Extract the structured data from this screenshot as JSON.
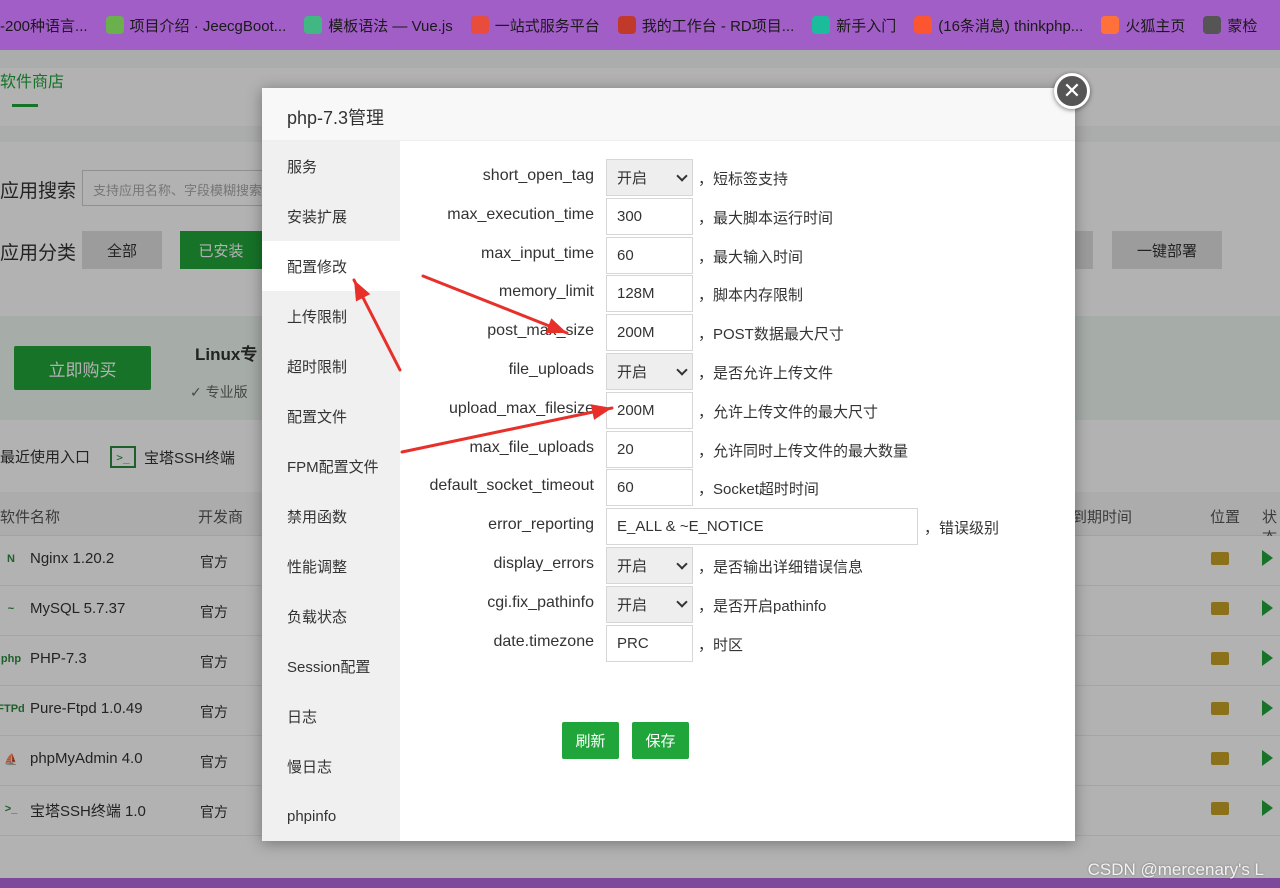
{
  "bookmarks": [
    {
      "label": "-200种语言...",
      "icon": "",
      "color": ""
    },
    {
      "label": "项目介绍 · JeecgBoot...",
      "icon": "jeecg-icon",
      "color": "#6ab04c"
    },
    {
      "label": "模板语法 — Vue.js",
      "icon": "vue-icon",
      "color": "#41b883"
    },
    {
      "label": "一站式服务平台",
      "icon": "service-icon",
      "color": "#e74c3c"
    },
    {
      "label": "我的工作台 - RD项目...",
      "icon": "redmine-icon",
      "color": "#c0392b"
    },
    {
      "label": "新手入门",
      "icon": "guide-icon",
      "color": "#1abc9c"
    },
    {
      "label": "(16条消息) thinkphp...",
      "icon": "csdn-icon",
      "color": "#fc5531"
    },
    {
      "label": "火狐主页",
      "icon": "firefox-icon",
      "color": "#ff7139"
    },
    {
      "label": "蒙检",
      "icon": "globe-icon",
      "color": "#555555"
    }
  ],
  "background": {
    "tab": "软件商店",
    "search_label": "应用搜索",
    "search_placeholder": "支持应用名称、字段模糊搜索",
    "category_label": "应用分类",
    "category_buttons": [
      "全部",
      "已安装"
    ],
    "deploy_button": "一键部署",
    "buy_button": "立即购买",
    "promo_title": "Linux专",
    "promo_sub": "✓ 专业版",
    "recent_entry": "最近使用入口",
    "ssh_terminal": "宝塔SSH终端",
    "table_headers": {
      "name": "软件名称",
      "developer": "开发商",
      "expiry": "到期时间",
      "location": "位置",
      "status": "状态"
    },
    "rows": [
      {
        "name": "Nginx 1.20.2",
        "developer": "官方",
        "icon": "nginx-icon",
        "icon_text": "N"
      },
      {
        "name": "MySQL 5.7.37",
        "developer": "官方",
        "icon": "mysql-icon",
        "icon_text": "~"
      },
      {
        "name": "PHP-7.3",
        "developer": "官方",
        "icon": "php-icon",
        "icon_text": "php"
      },
      {
        "name": "Pure-Ftpd 1.0.49",
        "developer": "官方",
        "icon": "ftp-icon",
        "icon_text": "FTPd"
      },
      {
        "name": "phpMyAdmin 4.0",
        "developer": "官方",
        "icon": "phpmyadmin-icon",
        "icon_text": "⛵"
      },
      {
        "name": "宝塔SSH终端 1.0",
        "developer": "官方",
        "icon": "terminal-icon",
        "icon_text": ">_"
      }
    ]
  },
  "modal": {
    "title": "php-7.3管理",
    "close_icon": "close-icon",
    "sidebar": [
      "服务",
      "安装扩展",
      "配置修改",
      "上传限制",
      "超时限制",
      "配置文件",
      "FPM配置文件",
      "禁用函数",
      "性能调整",
      "负载状态",
      "Session配置",
      "日志",
      "慢日志",
      "phpinfo"
    ],
    "active_sidebar": "配置修改",
    "fields": [
      {
        "label": "short_open_tag",
        "type": "select",
        "value": "开启",
        "desc": "，短标签支持"
      },
      {
        "label": "max_execution_time",
        "type": "input",
        "value": "300",
        "desc": "，最大脚本运行时间"
      },
      {
        "label": "max_input_time",
        "type": "input",
        "value": "60",
        "desc": "，最大输入时间"
      },
      {
        "label": "memory_limit",
        "type": "input",
        "value": "128M",
        "desc": "，脚本内存限制"
      },
      {
        "label": "post_max_size",
        "type": "input",
        "value": "200M",
        "desc": "，POST数据最大尺寸"
      },
      {
        "label": "file_uploads",
        "type": "select",
        "value": "开启",
        "desc": "，是否允许上传文件"
      },
      {
        "label": "upload_max_filesize",
        "type": "input",
        "value": "200M",
        "desc": "，允许上传文件的最大尺寸"
      },
      {
        "label": "max_file_uploads",
        "type": "input",
        "value": "20",
        "desc": "，允许同时上传文件的最大数量"
      },
      {
        "label": "default_socket_timeout",
        "type": "input",
        "value": "60",
        "desc": "，Socket超时时间"
      },
      {
        "label": "error_reporting",
        "type": "wide",
        "value": "E_ALL & ~E_NOTICE",
        "desc": "，错误级别"
      },
      {
        "label": "display_errors",
        "type": "select",
        "value": "开启",
        "desc": "，是否输出详细错误信息"
      },
      {
        "label": "cgi.fix_pathinfo",
        "type": "select",
        "value": "开启",
        "desc": "，是否开启pathinfo"
      },
      {
        "label": "date.timezone",
        "type": "input",
        "value": "PRC",
        "desc": "，时区"
      }
    ],
    "refresh_button": "刷新",
    "save_button": "保存"
  },
  "annotation_color": "#e8302a",
  "watermark": "CSDN @mercenary's L"
}
